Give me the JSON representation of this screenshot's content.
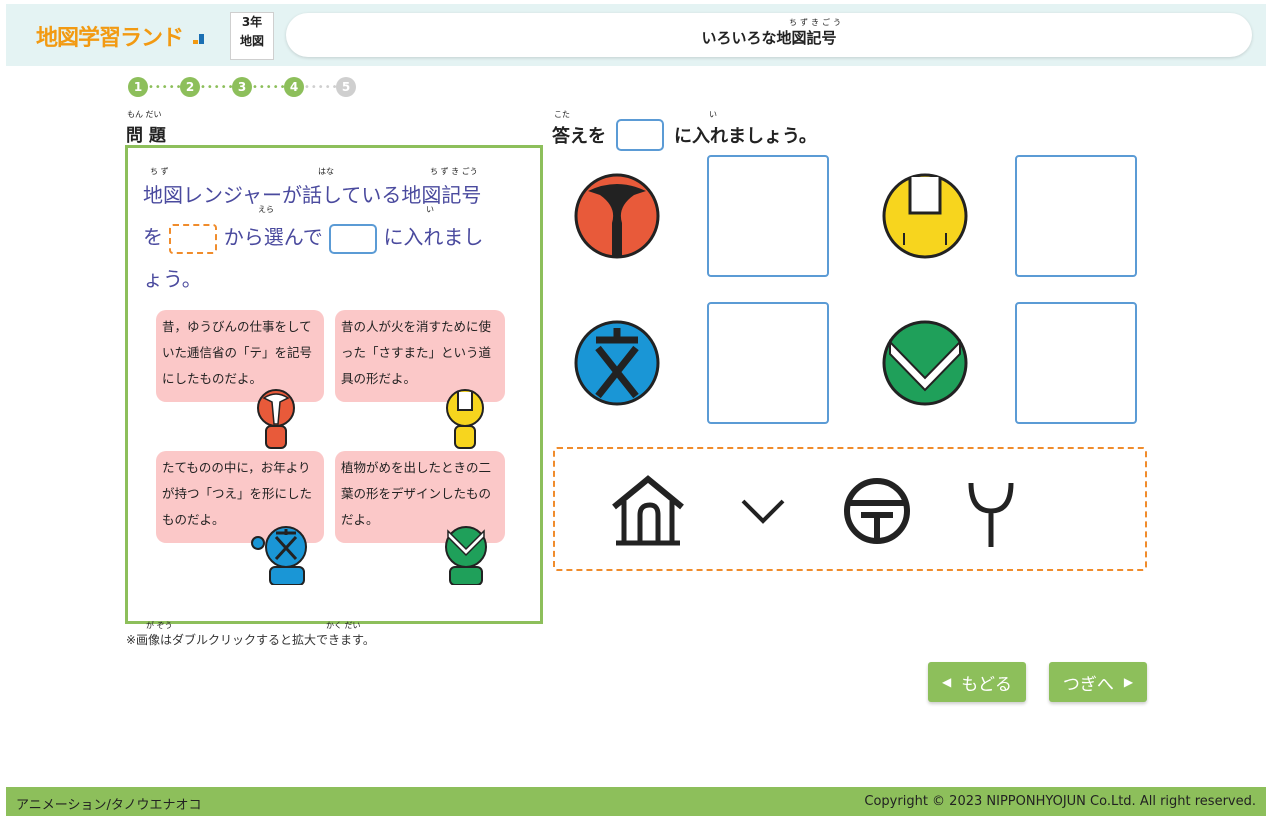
{
  "header": {
    "logo": "地図学習ランド",
    "grade_line1": "3年",
    "grade_line2": "地図",
    "title": "いろいろな地図記号",
    "title_ruby": "ちずきごう"
  },
  "steps": [
    "1",
    "2",
    "3",
    "4",
    "5"
  ],
  "problem": {
    "heading": "問 題",
    "heading_ruby": "もん だい",
    "line1": "地図レンジャーが話している地図記号",
    "line2_a": "を",
    "line2_b": "から選んで",
    "line2_c": "に入れまし",
    "line3": "ょう。",
    "ruby_chizu": "ち ず",
    "ruby_hana": "はな",
    "ruby_chizukigou": "ち ず き ごう",
    "ruby_era": "えら",
    "ruby_i": "い",
    "bubbles": [
      {
        "text": "昔，ゆうびんの仕事をしていた逓信省の「テ」を記号にしたものだよ。",
        "color": "red"
      },
      {
        "text": "昔の人が火を消すために使った「さすまた」という道具の形だよ。",
        "color": "yellow"
      },
      {
        "text": "たてものの中に，お年よりが持つ「つえ」を形にしたものだよ。",
        "color": "blue"
      },
      {
        "text": "植物がめを出したときの二葉の形をデザインしたものだよ。",
        "color": "green"
      }
    ]
  },
  "note": "※画像はダブルクリックすると拡大できます。",
  "answer": {
    "heading_a": "答えを",
    "heading_b": "に入れましょう。",
    "ruby_kota": "こた",
    "ruby_i": "い"
  },
  "symbols": [
    {
      "name": "red-sasumata-symbol",
      "color": "#e85a3a"
    },
    {
      "name": "yellow-symbol",
      "color": "#f7d51e"
    },
    {
      "name": "blue-symbol",
      "color": "#1a96d6"
    },
    {
      "name": "green-symbol",
      "color": "#1fa05a"
    }
  ],
  "choices": [
    "house-cane-symbol",
    "sprout-symbol",
    "post-office-symbol",
    "sasumata-symbol"
  ],
  "nav": {
    "back": "もどる",
    "next": "つぎへ"
  },
  "footer": {
    "left": "アニメーション/タノウエナオコ",
    "right": "Copyright © 2023 NIPPONHYOJUN Co.Ltd. All right reserved."
  }
}
